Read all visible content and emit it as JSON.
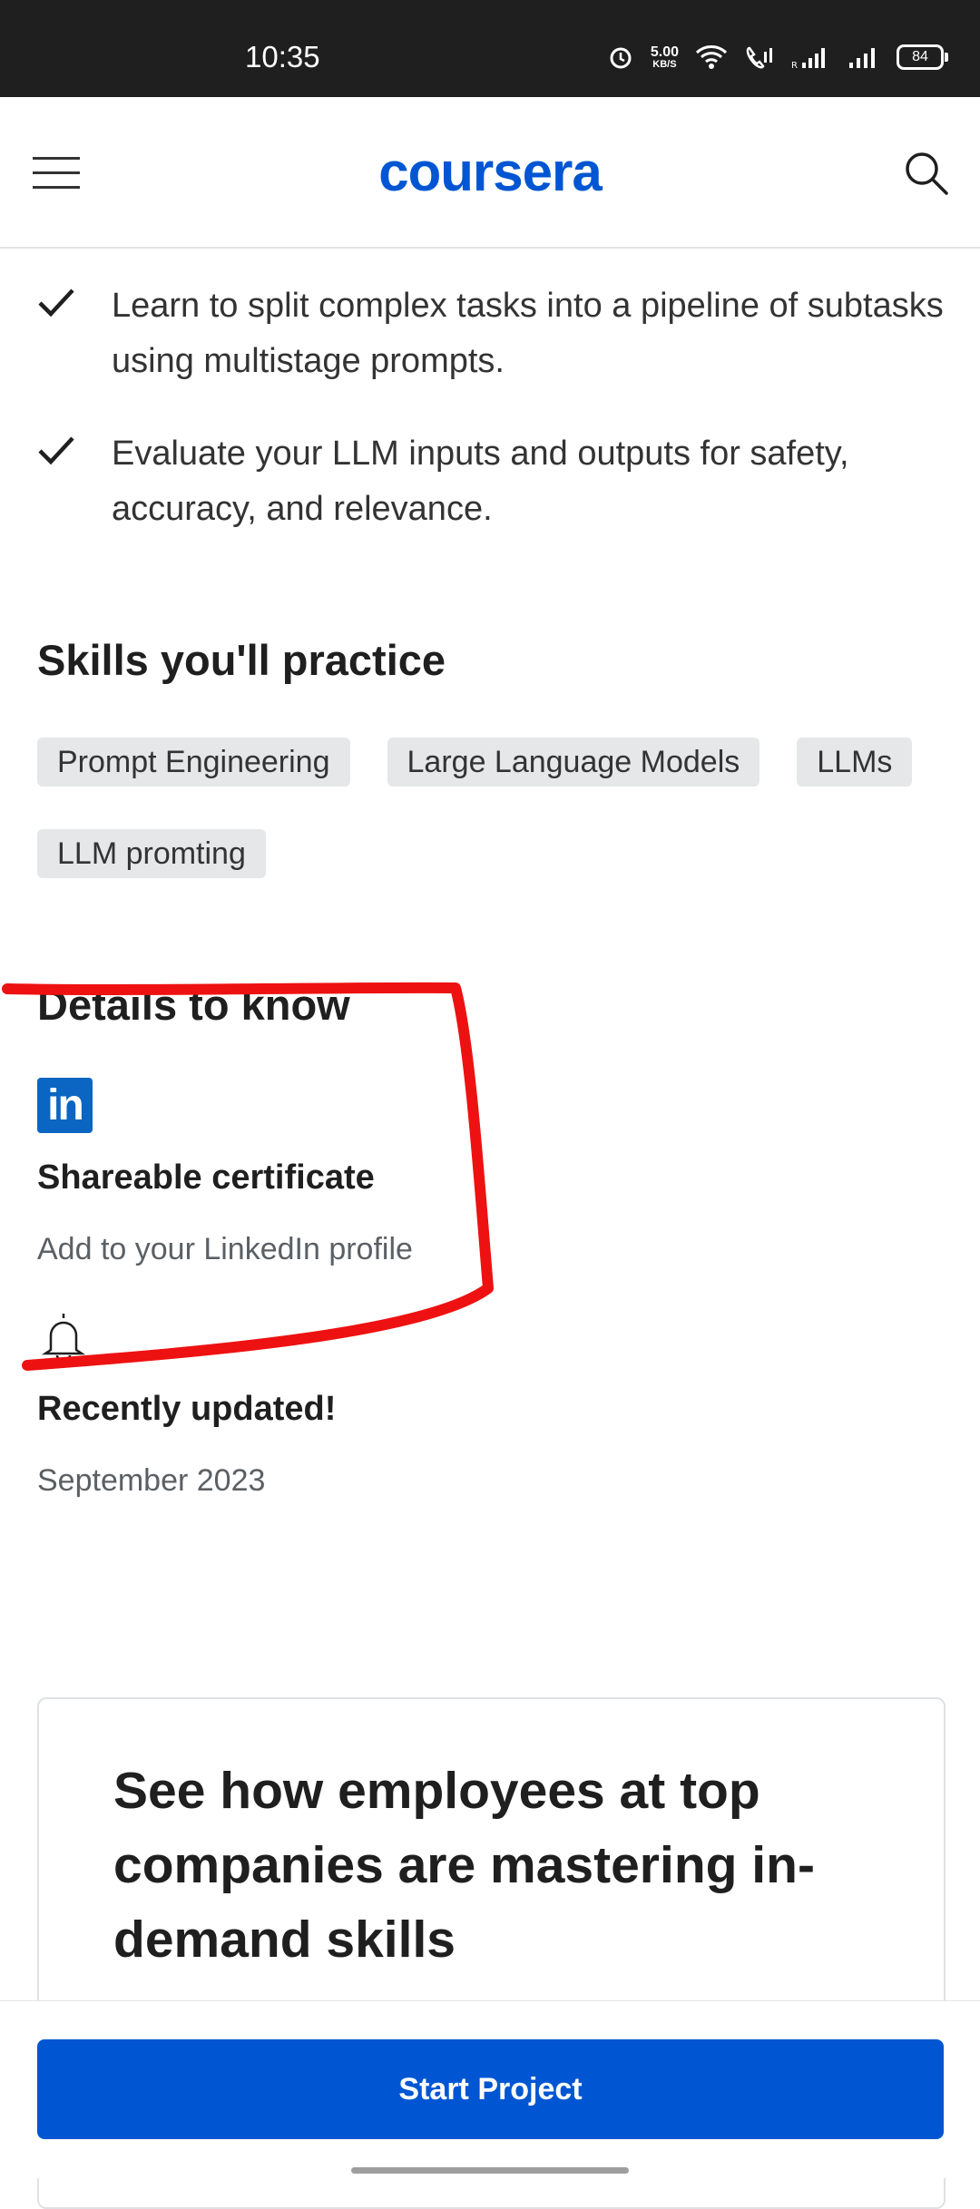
{
  "status_bar": {
    "time": "10:35",
    "speed_value": "5.00",
    "speed_unit": "KB/S",
    "battery": "84"
  },
  "header": {
    "logo": "coursera",
    "menu_icon": "hamburger-menu-icon",
    "search_icon": "search-icon"
  },
  "outcomes": [
    {
      "text": "Learn to split complex tasks into a pipeline of subtasks using multistage prompts."
    },
    {
      "text": "Evaluate your LLM inputs and outputs for safety, accuracy, and relevance."
    }
  ],
  "skills": {
    "title": "Skills you'll practice",
    "items": [
      "Prompt Engineering",
      "Large Language Models",
      "LLMs",
      "LLM promting"
    ]
  },
  "details": {
    "title": "Details to know",
    "certificate": {
      "title": "Shareable certificate",
      "subtitle": "Add to your LinkedIn profile"
    },
    "update": {
      "title": "Recently updated!",
      "subtitle": "September 2023"
    }
  },
  "card": {
    "title": "See how employees at top companies are mastering in-demand skills"
  },
  "cta": {
    "label": "Start Project"
  },
  "colors": {
    "brand": "#0056d2",
    "annotation": "#ee1111"
  }
}
